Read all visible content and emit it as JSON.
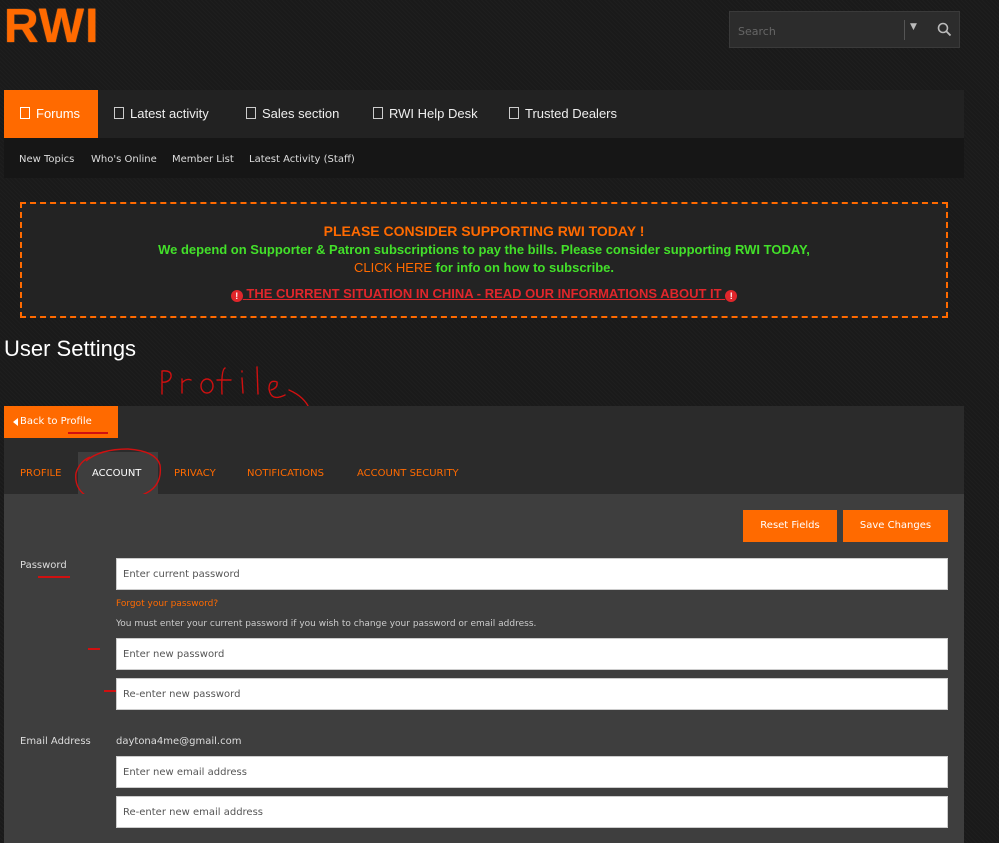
{
  "logo": {
    "text": "RWI"
  },
  "search": {
    "placeholder": "Search"
  },
  "nav": [
    {
      "label": "Forums",
      "active": true
    },
    {
      "label": "Latest activity"
    },
    {
      "label": "Sales section"
    },
    {
      "label": "RWI Help Desk"
    },
    {
      "label": "Trusted Dealers"
    }
  ],
  "subnav": [
    "New Topics",
    "Who's Online",
    "Member List",
    "Latest Activity (Staff)"
  ],
  "notice": {
    "line1": "PLEASE CONSIDER SUPPORTING RWI TODAY !",
    "line2": "We depend on Supporter & Patron subscriptions to pay the bills. Please consider supporting RWI TODAY,",
    "click_here": "CLICK HERE",
    "line3_rest": " for info on how to subscribe.",
    "warning": "THE CURRENT SITUATION IN CHINA - READ OUR INFORMATIONS ABOUT IT"
  },
  "page_title": "User Settings",
  "annotation": "Profile",
  "back_button": "Back to Profile",
  "tabs": [
    "PROFILE",
    "ACCOUNT",
    "PRIVACY",
    "NOTIFICATIONS",
    "ACCOUNT SECURITY"
  ],
  "active_tab": "ACCOUNT",
  "buttons": {
    "reset": "Reset Fields",
    "save": "Save Changes"
  },
  "password": {
    "label": "Password",
    "current_placeholder": "Enter current password",
    "forgot": "Forgot your password?",
    "hint": "You must enter your current password if you wish to change your password or email address.",
    "new_placeholder": "Enter new password",
    "reenter_placeholder": "Re-enter new password"
  },
  "email": {
    "label": "Email Address",
    "current": "daytona4me@gmail.com",
    "new_placeholder": "Enter new email address",
    "reenter_placeholder": "Re-enter new email address"
  },
  "colors": {
    "accent": "#ff6a00",
    "green": "#43e02a",
    "red": "#e0262b"
  }
}
